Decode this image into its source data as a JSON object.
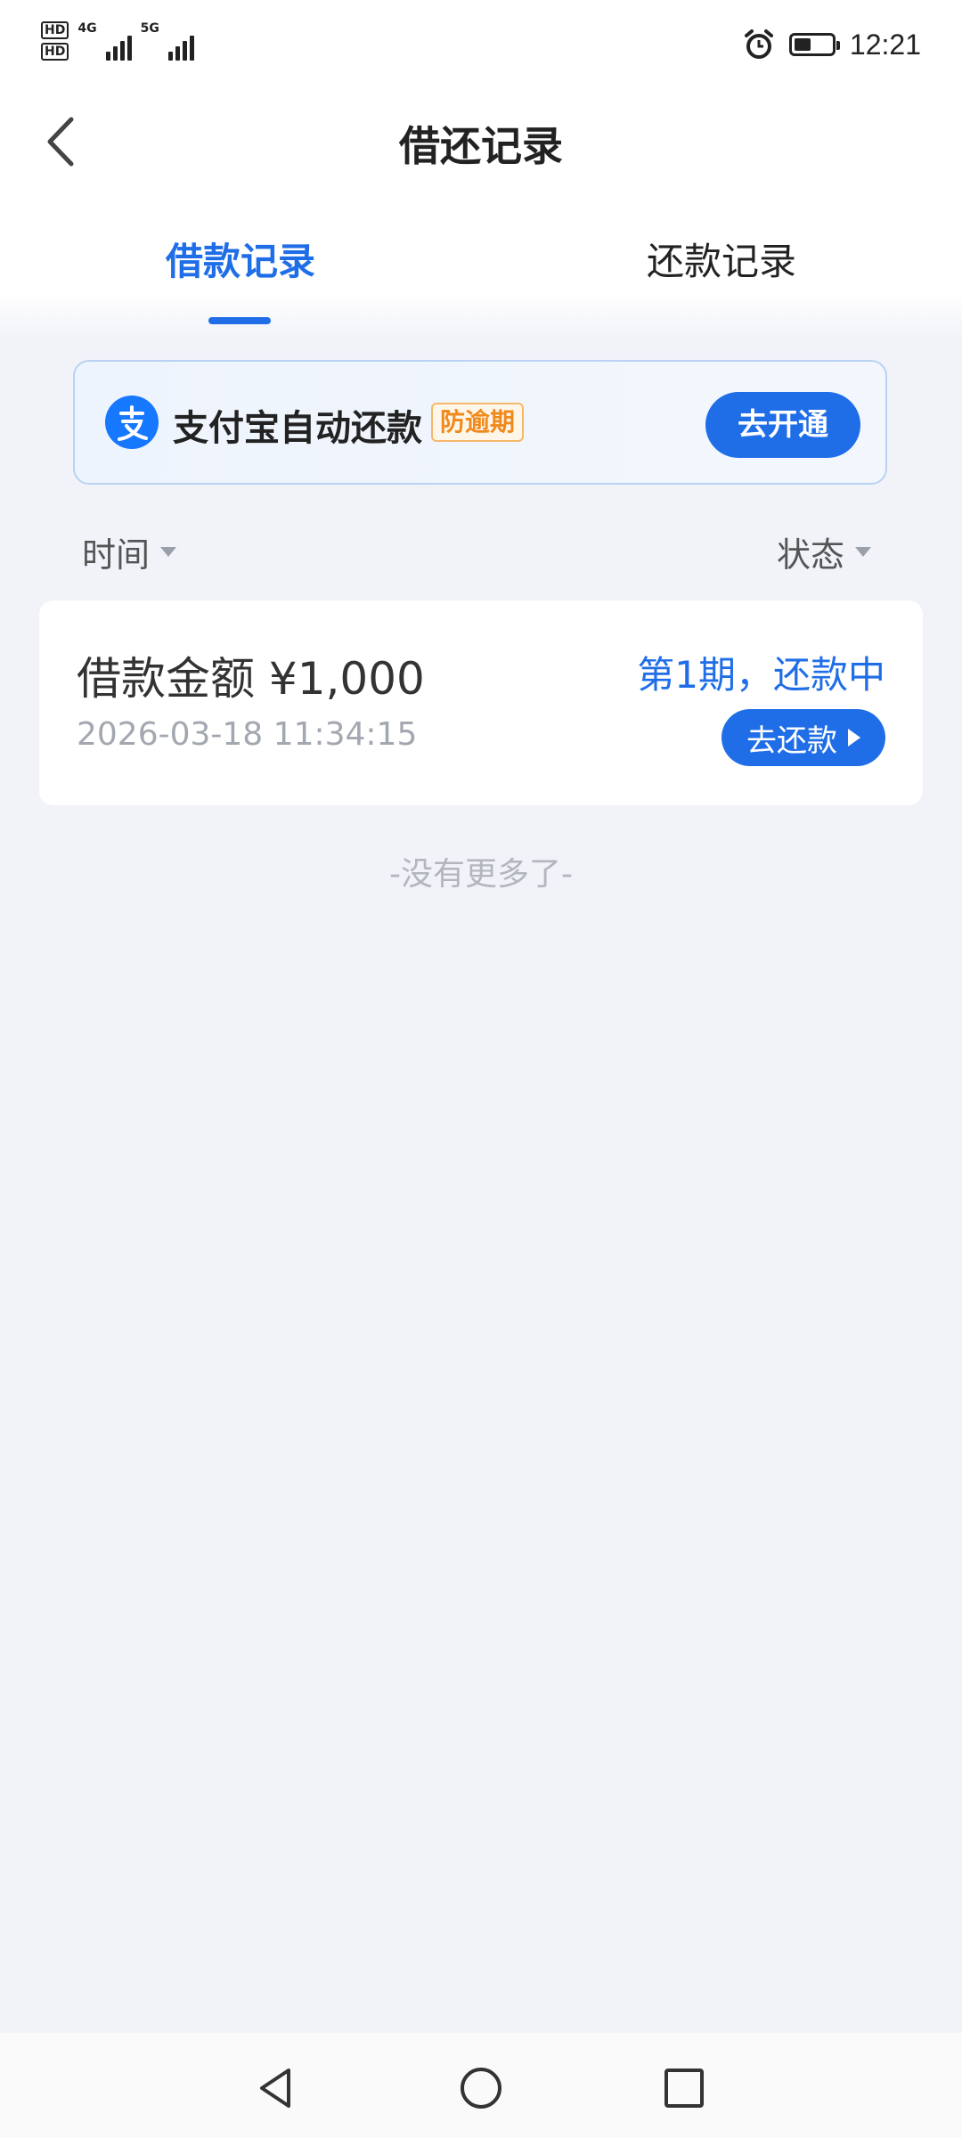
{
  "status_bar": {
    "hd_top": "HD",
    "hd_bottom": "HD",
    "network_1": "4G",
    "network_2": "5G",
    "time": "12:21"
  },
  "header": {
    "title": "借还记录",
    "back_icon": "chevron-left-icon"
  },
  "tabs": [
    {
      "label": "借款记录",
      "active": true
    },
    {
      "label": "还款记录",
      "active": false
    }
  ],
  "promo": {
    "icon": "alipay-logo",
    "title": "支付宝自动还款",
    "tag": "防逾期",
    "button": "去开通"
  },
  "filters": {
    "time_label": "时间",
    "status_label": "状态"
  },
  "records": [
    {
      "amount": "借款金额 ¥1,000",
      "date": "2026-03-18 11:34:15",
      "status": "第1期，还款中",
      "button": "去还款"
    }
  ],
  "footer_text": "-没有更多了-",
  "colors": {
    "accent": "#1f6ee8",
    "background": "#f1f3f9",
    "tag_orange": "#f08a1c"
  }
}
